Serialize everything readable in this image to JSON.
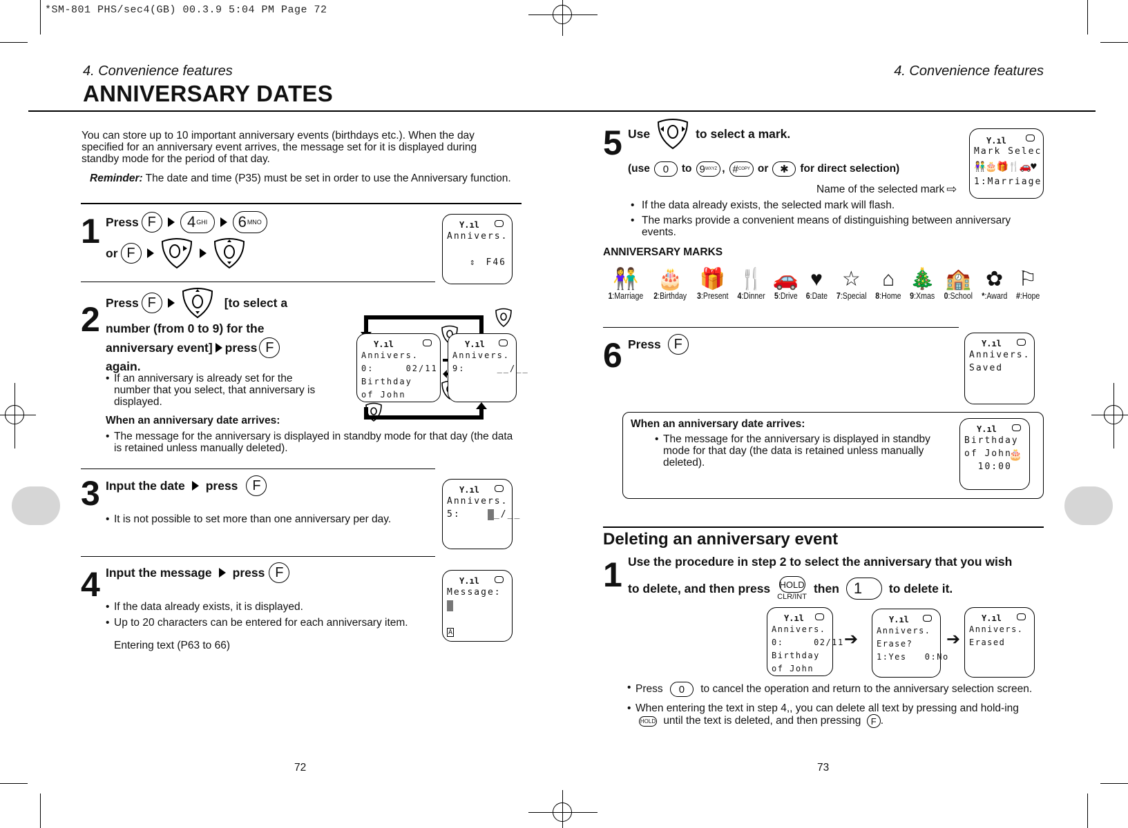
{
  "slug": "*SM-801 PHS/sec4(GB)  00.3.9 5:04 PM  Page 72",
  "left_page": {
    "section": "4. Convenience features",
    "title": "ANNIVERSARY DATES",
    "intro": "You can store up to 10 important anniversary events (birthdays etc.). When the day specified for an anniversary event arrives, the message set for it is displayed during standby mode for the period of that day.",
    "reminder_label": "Reminder:",
    "reminder_text": "The date and time (P35) must be set in order to use the Anniversary function.",
    "page_number": "72",
    "steps": [
      {
        "number": "1",
        "press": "Press",
        "or": "or",
        "keys": [
          "F",
          "4 GHI",
          "6 MNO"
        ],
        "screen": {
          "line1": "Annivers.",
          "footer": "F46"
        }
      },
      {
        "number": "2",
        "press": "Press",
        "text_a": "[to select a",
        "text_b": "number (from 0 to 9) for the",
        "text_c": "anniversary event]",
        "text_d": "press",
        "text_e": "again.",
        "bullet": "If an anniversary is already set for the number that you select, that anniversary is displayed.",
        "arrives_heading": "When an anniversary date arrives:",
        "arrives_bullet": "The message for the anniversary is displayed in standby mode for that day (the data is retained unless manually deleted).",
        "screen_a": {
          "line1": "Annivers.",
          "line2": "0:     02/11",
          "line3": "Birthday",
          "line4": "of John"
        },
        "screen_b": {
          "line1": "Annivers.",
          "line2": "9:     __/__"
        }
      },
      {
        "number": "3",
        "text": "Input the date",
        "press": "press",
        "bullet": "It is not possible to set more than one anniversary per day.",
        "screen": {
          "line1": "Annivers.",
          "line2_prefix": "5:    ",
          "line2_suffix": "_/__"
        }
      },
      {
        "number": "4",
        "text": "Input the message",
        "press": "press",
        "bullets": [
          "If the data already exists, it is displayed.",
          "Up to 20 characters can be entered for each anniversary item."
        ],
        "note": "Entering text (P63 to 66)",
        "screen": {
          "line1": "Message:",
          "mode": "A"
        }
      }
    ]
  },
  "right_page": {
    "section": "4. Convenience features",
    "page_number": "73",
    "step5": {
      "number": "5",
      "use": "Use",
      "text": "to select a mark.",
      "direct_prefix": "(use",
      "to": "to",
      "comma": ",",
      "or": "or",
      "direct_suffix": "for direct selection)",
      "keys": [
        "0",
        "9 WXYZ",
        "# COPY",
        "*"
      ],
      "mark_caption": "Name of the selected mark",
      "bullets": [
        "If the data already exists, the selected mark will flash.",
        "The marks provide a convenient means of distinguishing between anniversary events."
      ],
      "screen": {
        "line1": "Mark Selec",
        "line3": "1:Marriage"
      }
    },
    "marks_heading": "ANNIVERSARY MARKS",
    "marks": [
      {
        "key": "1",
        "name": "Marriage",
        "icon": "couple-icon",
        "glyph": "👫"
      },
      {
        "key": "2",
        "name": "Birthday",
        "icon": "cake-icon",
        "glyph": "🎂"
      },
      {
        "key": "3",
        "name": "Present",
        "icon": "gift-icon",
        "glyph": "🎁"
      },
      {
        "key": "4",
        "name": "Dinner",
        "icon": "fork-knife-icon",
        "glyph": "🍴"
      },
      {
        "key": "5",
        "name": "Drive",
        "icon": "car-icon",
        "glyph": "🚗"
      },
      {
        "key": "6",
        "name": "Date",
        "icon": "heart-icon",
        "glyph": "♥"
      },
      {
        "key": "7",
        "name": "Special",
        "icon": "star-icon",
        "glyph": "☆"
      },
      {
        "key": "8",
        "name": "Home",
        "icon": "house-icon",
        "glyph": "⌂"
      },
      {
        "key": "9",
        "name": "Xmas",
        "icon": "tree-icon",
        "glyph": "🎄"
      },
      {
        "key": "0",
        "name": "School",
        "icon": "school-icon",
        "glyph": "🏫"
      },
      {
        "key": "*",
        "name": "Award",
        "icon": "clover-icon",
        "glyph": "✿"
      },
      {
        "key": "#",
        "name": "Hope",
        "icon": "hope-icon",
        "glyph": "⚐"
      }
    ],
    "step6": {
      "number": "6",
      "press": "Press",
      "screen": {
        "line1": "Annivers.",
        "line2": "Saved"
      }
    },
    "arrives_box": {
      "heading": "When an anniversary date arrives:",
      "bullet": "The message for the anniversary is displayed in standby mode for that day (the data is retained unless manually deleted).",
      "screen": {
        "line1": "Birthday",
        "line2": "of John",
        "line3": "  10:00"
      }
    },
    "delete": {
      "heading": "Deleting an anniversary event",
      "number": "1",
      "line1": "Use the procedure in step 2 to select the anniversary that you wish",
      "line2_a": "to delete, and then press",
      "then": "then",
      "line2_b": "to delete it.",
      "hold_key": "HOLD",
      "hold_sub": "CLR/INT",
      "one_key": "1",
      "screens": [
        {
          "line1": "Annivers.",
          "line2": "0:     02/11",
          "line3": "Birthday",
          "line4": "of John"
        },
        {
          "line1": "Annivers.",
          "line2": "Erase?",
          "line3": "1:Yes   0:No"
        },
        {
          "line1": "Annivers.",
          "line2": "Erased"
        }
      ],
      "bullet1_a": "Press",
      "bullet1_key": "0",
      "bullet1_b": "to cancel the operation and return to the anniversary selection screen.",
      "bullet2_a": "When entering the text in step 4,, you can delete all text by pressing and hold-ing",
      "bullet2_b": "until the text is deleted, and then pressing",
      "bullet2_end": "."
    }
  }
}
